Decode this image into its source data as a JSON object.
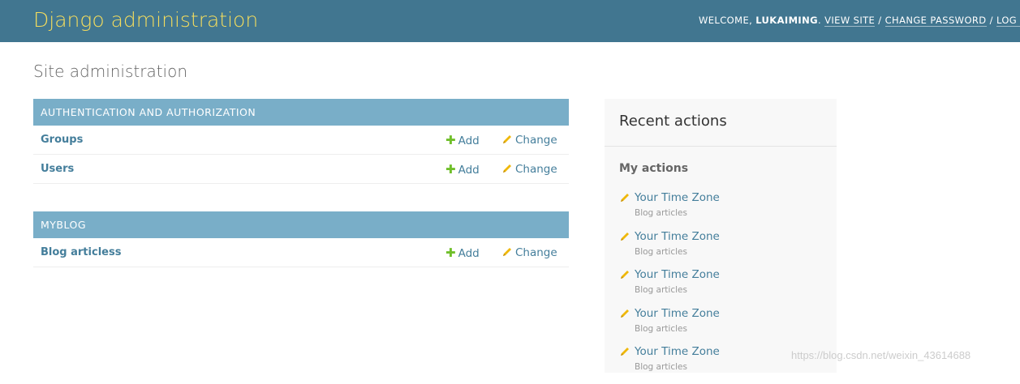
{
  "header": {
    "site_title": "Django administration",
    "welcome_label": "WELCOME, ",
    "username": "LUKAIMING",
    "welcome_suffix": ". ",
    "view_site": "VIEW SITE",
    "sep1": " / ",
    "change_password": "CHANGE PASSWORD",
    "sep2": " / ",
    "log_out": "LOG OUT"
  },
  "page_title": "Site administration",
  "modules": [
    {
      "caption": "AUTHENTICATION AND AUTHORIZATION",
      "models": [
        {
          "name": "Groups",
          "add": "Add",
          "change": "Change"
        },
        {
          "name": "Users",
          "add": "Add",
          "change": "Change"
        }
      ]
    },
    {
      "caption": "MYBLOG",
      "models": [
        {
          "name": "Blog articless",
          "add": "Add",
          "change": "Change"
        }
      ]
    }
  ],
  "recent_actions": {
    "title": "Recent actions",
    "subtitle": "My actions",
    "items": [
      {
        "title": "Your Time Zone",
        "type": "Blog articles"
      },
      {
        "title": "Your Time Zone",
        "type": "Blog articles"
      },
      {
        "title": "Your Time Zone",
        "type": "Blog articles"
      },
      {
        "title": "Your Time Zone",
        "type": "Blog articles"
      },
      {
        "title": "Your Time Zone",
        "type": "Blog articles"
      }
    ]
  },
  "watermark": "https://blog.csdn.net/weixin_43614688",
  "colors": {
    "header_bg": "#417690",
    "branding": "#f5dd5d",
    "module_caption_bg": "#79aec8",
    "link": "#447e9b",
    "add_icon": "#70bf2b",
    "change_icon": "#efb80b"
  }
}
